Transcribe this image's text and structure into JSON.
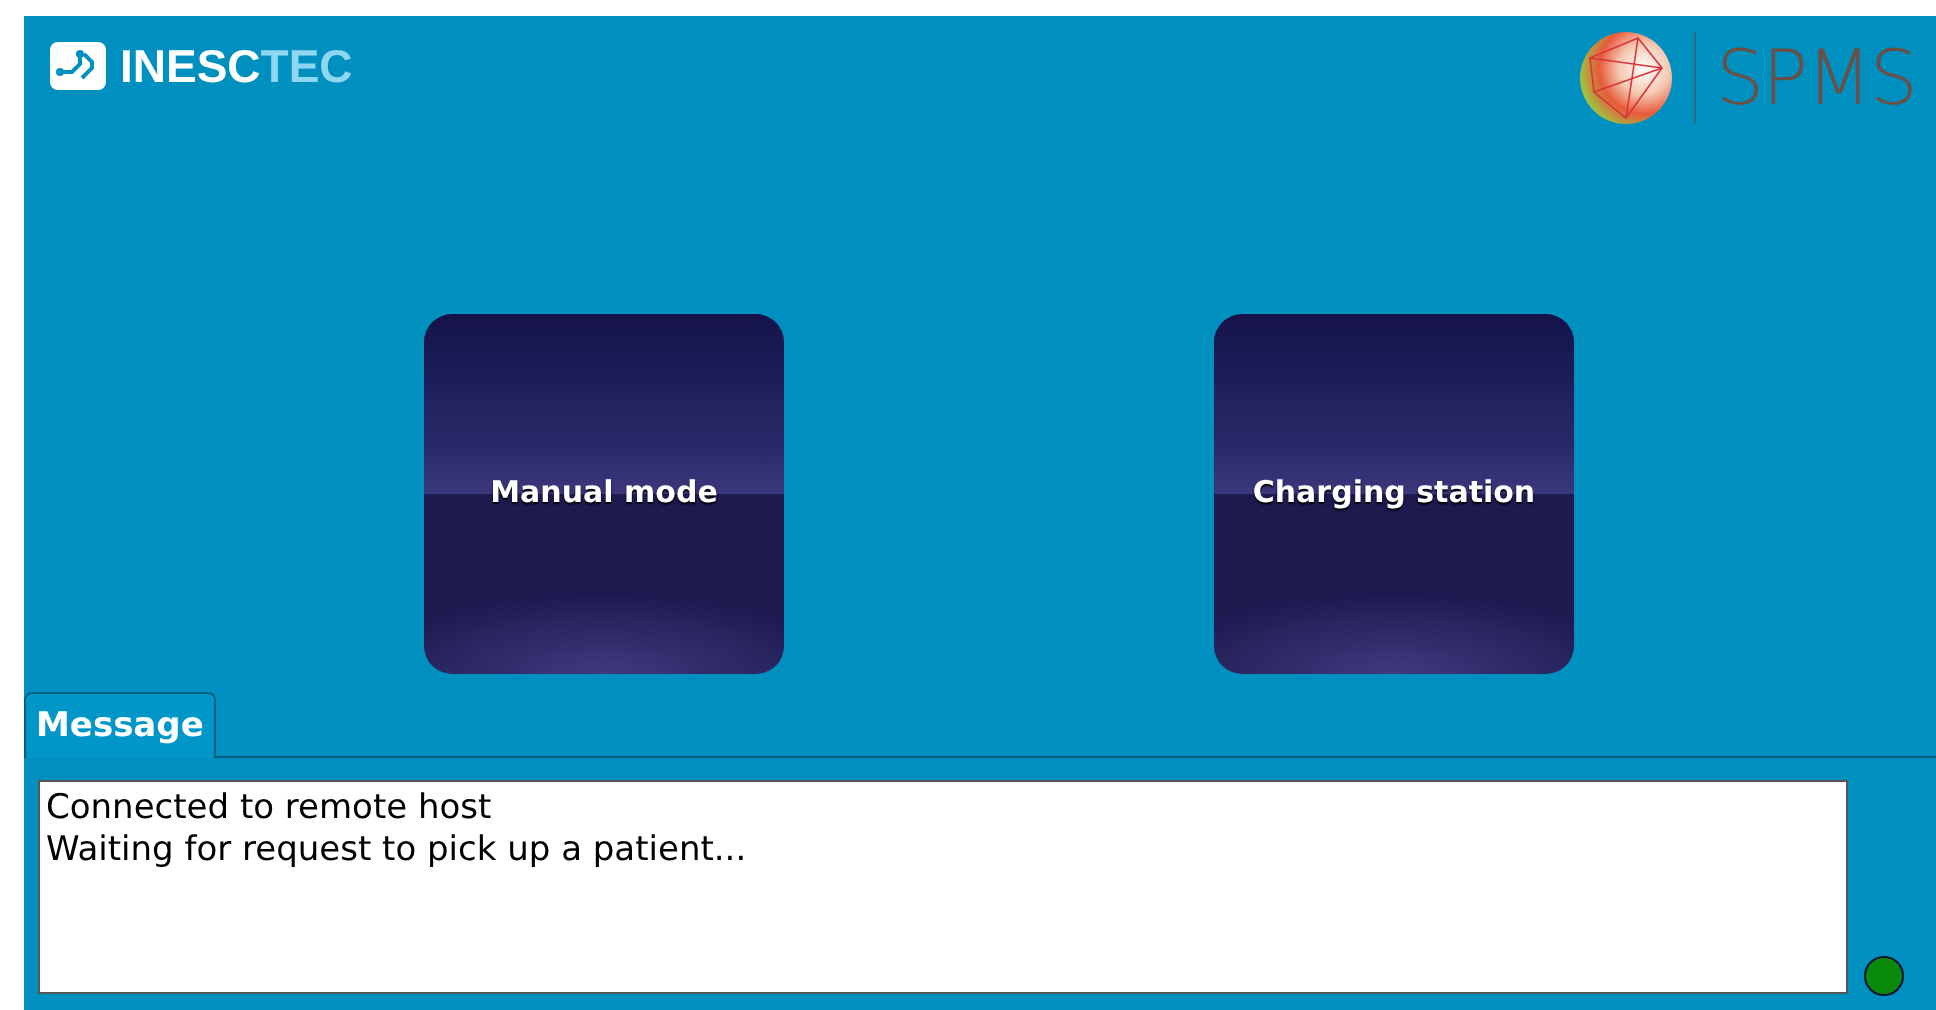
{
  "header": {
    "logo_left": {
      "primary": "INESC",
      "accent": "TEC"
    },
    "logo_right": "SPMS"
  },
  "mode_buttons": [
    {
      "label": "Manual mode"
    },
    {
      "label": "Charging station"
    }
  ],
  "tabs": [
    {
      "label": "Message",
      "selected": true
    }
  ],
  "messages": [
    "Connected to remote host",
    "Waiting for request to pick up a patient..."
  ],
  "status": {
    "connected": true
  }
}
